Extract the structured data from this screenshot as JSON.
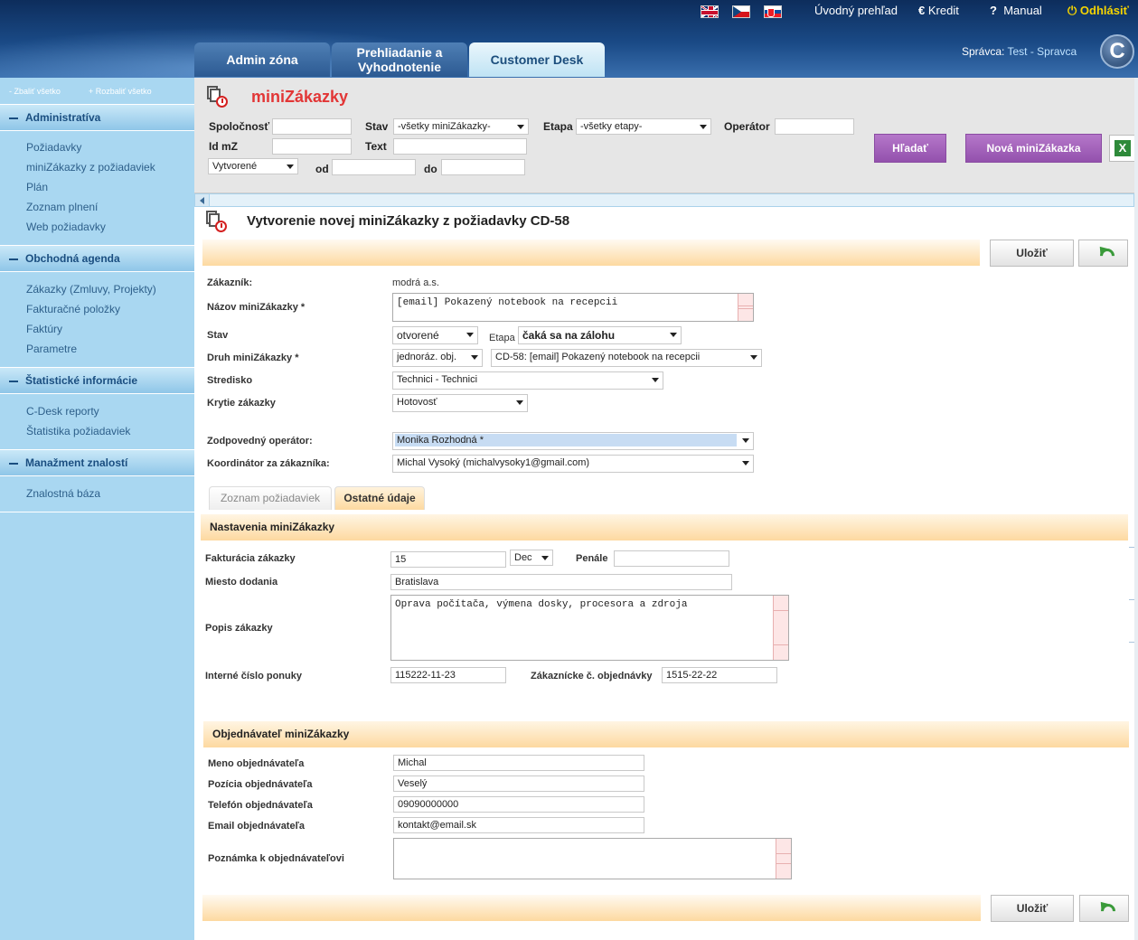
{
  "header": {
    "flags": [
      {
        "name": "en-flag-icon"
      },
      {
        "name": "cz-flag-icon"
      },
      {
        "name": "sk-flag-icon"
      }
    ],
    "links": {
      "overview": "Úvodný prehľad",
      "credit_icon": "€",
      "credit": "Kredit",
      "manual_icon": "?",
      "manual": "Manual",
      "logout_icon": "⏻",
      "logout": "Odhlásiť"
    },
    "tabs": [
      "Admin zóna",
      "Prehliadanie a Vyhodnotenie",
      "Customer Desk"
    ],
    "admin_label": "Správca:",
    "admin_name": "Test - Spravca",
    "logo_letter": "C"
  },
  "sidebar": {
    "collapse_all": "- Zbaliť všetko",
    "expand_all": "+ Rozbaliť všetko",
    "sections": [
      {
        "title": "Administratíva",
        "items": [
          "Požiadavky",
          "miniZákazky z požiadaviek",
          "Plán",
          "Zoznam plnení",
          "Web požiadavky"
        ]
      },
      {
        "title": "Obchodná agenda",
        "items": [
          "Zákazky (Zmluvy, Projekty)",
          "Fakturačné položky",
          "Faktúry",
          "Parametre"
        ]
      },
      {
        "title": "Štatistické informácie",
        "items": [
          "C-Desk reporty",
          "Štatistika požiadaviek"
        ]
      },
      {
        "title": "Manažment znalostí",
        "items": [
          "Znalostná báza"
        ]
      }
    ]
  },
  "filter": {
    "title": "miniZákazky",
    "company_label": "Spoločnosť",
    "status_label": "Stav",
    "status_value": "-všetky miniZákazky-",
    "stage_label": "Etapa",
    "stage_value": "-všetky etapy-",
    "operator_label": "Operátor",
    "id_label": "Id mZ",
    "text_label": "Text",
    "date_type_value": "Vytvorené",
    "from_label": "od",
    "to_label": "do",
    "search_button": "Hľadať",
    "new_button": "Nová miniZákazka",
    "export_icon": "X"
  },
  "form": {
    "title": "Vytvorenie novej miniZákazky z požiadavky CD-58",
    "save_button": "Uložiť",
    "customer_label": "Zákazník:",
    "customer_value": "modrá a.s.",
    "name_label": "Názov miniZákazky *",
    "name_value": "[email] Pokazený notebook na recepcii",
    "status_label": "Stav",
    "status_value": "otvorené",
    "stage_label": "Etapa",
    "stage_value": "čaká sa na zálohu",
    "type_label": "Druh miniZákazky *",
    "type_value": "jednoráz. obj.",
    "request_value": "CD-58: [email] Pokazený notebook na recepcii",
    "center_label": "Stredisko",
    "center_value": "Technici - Technici",
    "coverage_label": "Krytie zákazky",
    "coverage_value": "Hotovosť",
    "operator_label": "Zodpovedný operátor:",
    "operator_value": "Monika Rozhodná *",
    "coordinator_label": "Koordinátor za zákazníka:",
    "coordinator_value": "Michal Vysoký (michalvysoky1@gmail.com)",
    "tabs": [
      "Zoznam požiadaviek",
      "Ostatné údaje"
    ]
  },
  "settings": {
    "section_title": "Nastavenia miniZákazky",
    "billing_label": "Fakturácia zákazky",
    "billing_value": "15",
    "billing_unit": "Dec",
    "penalty_label": "Penále",
    "place_label": "Miesto dodania",
    "place_value": "Bratislava",
    "description_label": "Popis zákazky",
    "description_value": "Oprava počítača, výmena dosky, procesora a zdroja",
    "offer_label": "Interné číslo ponuky",
    "offer_value": "115222-11-23",
    "order_label": "Zákaznícke č. objednávky",
    "order_value": "1515-22-22"
  },
  "orderer": {
    "section_title": "Objednávateľ miniZákazky",
    "name_label": "Meno objednávateľa",
    "name_value": "Michal",
    "position_label": "Pozícia objednávateľa",
    "position_value": "Veselý",
    "phone_label": "Telefón objednávateľa",
    "phone_value": "09090000000",
    "email_label": "Email objednávateľa",
    "email_value": "kontakt@email.sk",
    "note_label": "Poznámka k objednávateľovi"
  },
  "colors": {
    "accent_purple": "#9351ad",
    "title_red": "#e23636",
    "sidebar_blue": "#a9d7f1",
    "orange_bar": "#fdd9a0"
  }
}
